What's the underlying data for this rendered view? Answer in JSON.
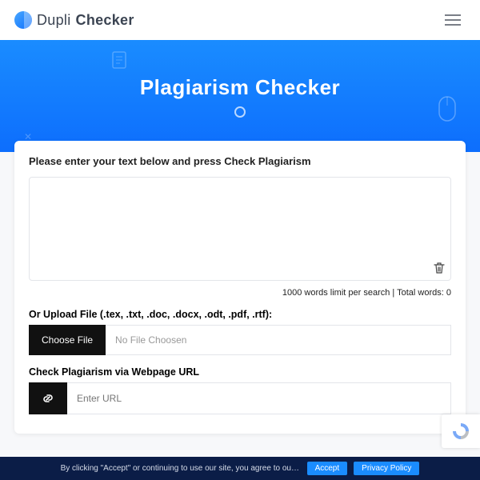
{
  "header": {
    "brand1": "Dupli",
    "brand2": "Checker"
  },
  "hero": {
    "title": "Plagiarism Checker"
  },
  "card": {
    "prompt": "Please enter your text below and press Check Plagiarism",
    "textarea_value": "",
    "counter": "1000 words limit per search | Total words: 0",
    "upload_label": "Or Upload File (.tex, .txt, .doc, .docx, .odt, .pdf, .rtf):",
    "choose_file": "Choose File",
    "no_file": "No File Choosen",
    "url_label": "Check Plagiarism via Webpage URL",
    "url_placeholder": "Enter URL"
  },
  "cookie": {
    "text": "By clicking \"Accept\" or continuing to use our site, you agree to our Privacy Policy for Website",
    "accept": "Accept",
    "policy": "Privacy Policy"
  }
}
